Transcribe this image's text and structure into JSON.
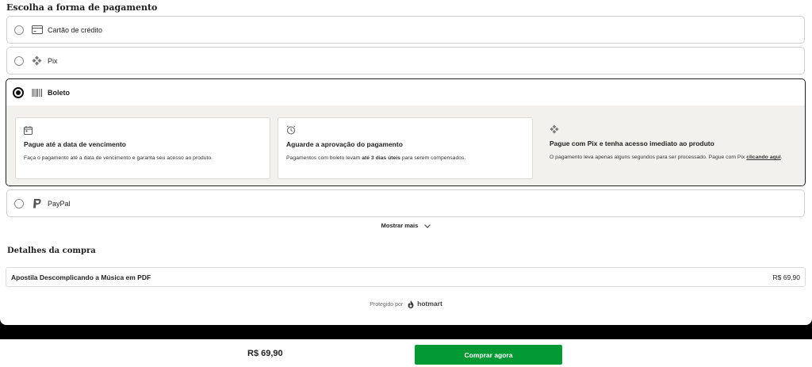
{
  "payment": {
    "title": "Escolha a forma de pagamento",
    "options": [
      {
        "label": "Cartão de crédito",
        "icon": "credit-card-icon",
        "selected": false
      },
      {
        "label": "Pix",
        "icon": "pix-icon",
        "selected": false
      },
      {
        "label": "Boleto",
        "icon": "barcode-icon",
        "selected": true
      },
      {
        "label": "PayPal",
        "icon": "paypal-icon",
        "selected": false
      }
    ],
    "boleto_info": [
      {
        "icon": "calendar-icon",
        "title": "Pague até a data de vencimento",
        "text": "Faça o pagamento até a data de vencimento e garanta seu acesso ao produto."
      },
      {
        "icon": "alarm-clock-icon",
        "title": "Aguarde a aprovação do pagamento",
        "text_before": "Pagamentos com boleto levam ",
        "text_bold": "até 3 dias úteis",
        "text_after": " para serem compensados."
      },
      {
        "icon": "pix-icon",
        "title": "Pague com Pix e tenha acesso imediato ao produto",
        "text": "O pagamento leva apenas alguns segundos para ser processado. Pague com Pix ",
        "link": "clicando aqui",
        "text_end": "."
      }
    ],
    "show_more": "Mostrar mais"
  },
  "details": {
    "title": "Detalhes da compra",
    "product_name": "Apostila Descomplicando a Música em PDF",
    "product_price": "R$ 69,90"
  },
  "footer": {
    "protected_by": "Protegido por",
    "brand": "hotmart"
  },
  "bottom_bar": {
    "total": "R$ 69,90",
    "buy_label": "Comprar agora"
  },
  "colors": {
    "buy_button": "#009933",
    "selected_border": "#1f1f1f",
    "boleto_panel": "#f2f1ee"
  }
}
